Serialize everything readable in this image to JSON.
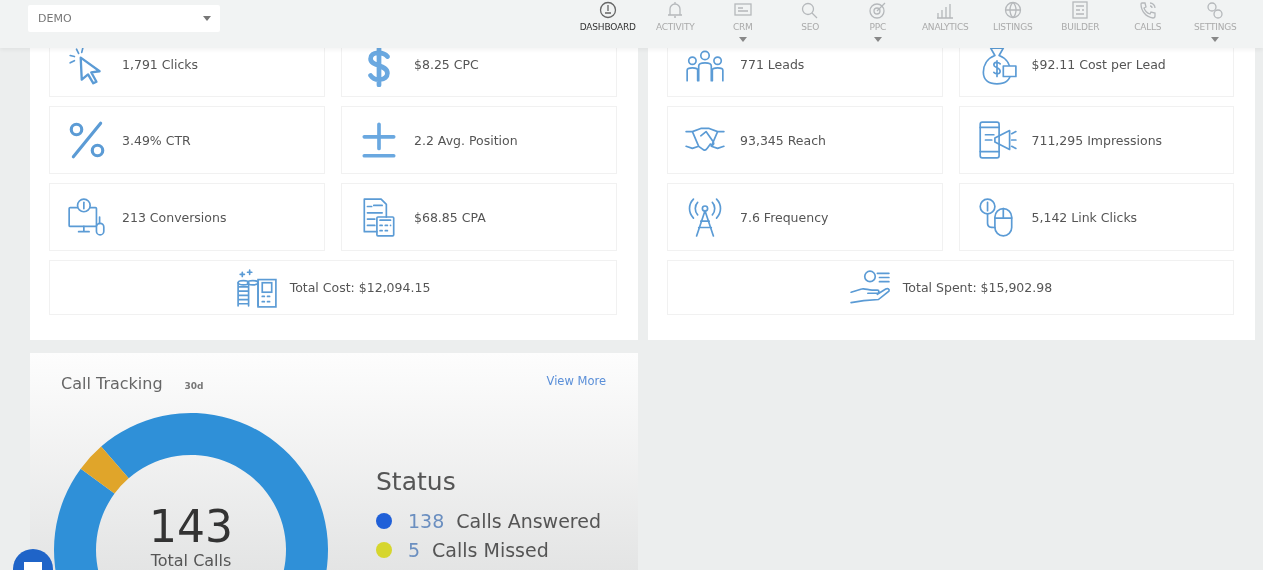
{
  "account_select": {
    "value": "DEMO"
  },
  "nav": [
    {
      "label": "DASHBOARD",
      "selected": true,
      "dropdown": false
    },
    {
      "label": "ACTIVITY",
      "selected": false,
      "dropdown": false
    },
    {
      "label": "CRM",
      "selected": false,
      "dropdown": true
    },
    {
      "label": "SEO",
      "selected": false,
      "dropdown": false
    },
    {
      "label": "PPC",
      "selected": false,
      "dropdown": true
    },
    {
      "label": "ANALYTICS",
      "selected": false,
      "dropdown": false
    },
    {
      "label": "LISTINGS",
      "selected": false,
      "dropdown": false
    },
    {
      "label": "BUILDER",
      "selected": false,
      "dropdown": false
    },
    {
      "label": "CALLS",
      "selected": false,
      "dropdown": false
    },
    {
      "label": "SETTINGS",
      "selected": false,
      "dropdown": true
    }
  ],
  "panels": [
    {
      "tiles": [
        "1,791 Clicks",
        "$8.25 CPC",
        "3.49% CTR",
        "2.2 Avg. Position",
        "213 Conversions",
        "$68.85 CPA"
      ],
      "total": "Total Cost: $12,094.15"
    },
    {
      "tiles": [
        "771 Leads",
        "$92.11 Cost per Lead",
        "93,345 Reach",
        "711,295 Impressions",
        "7.6 Frequency",
        "5,142 Link Clicks"
      ],
      "total": "Total Spent: $15,902.98"
    }
  ],
  "call_tracking": {
    "title": "Call Tracking",
    "period": "30d",
    "link": "View More",
    "center_value": "143",
    "center_label": "Total Calls",
    "legend_title": "Status",
    "legend": [
      {
        "count": "138",
        "label": "Calls Answered",
        "color": "#2060d8"
      },
      {
        "count": "5",
        "label": "Calls Missed",
        "color": "#d6d62e"
      }
    ]
  }
}
